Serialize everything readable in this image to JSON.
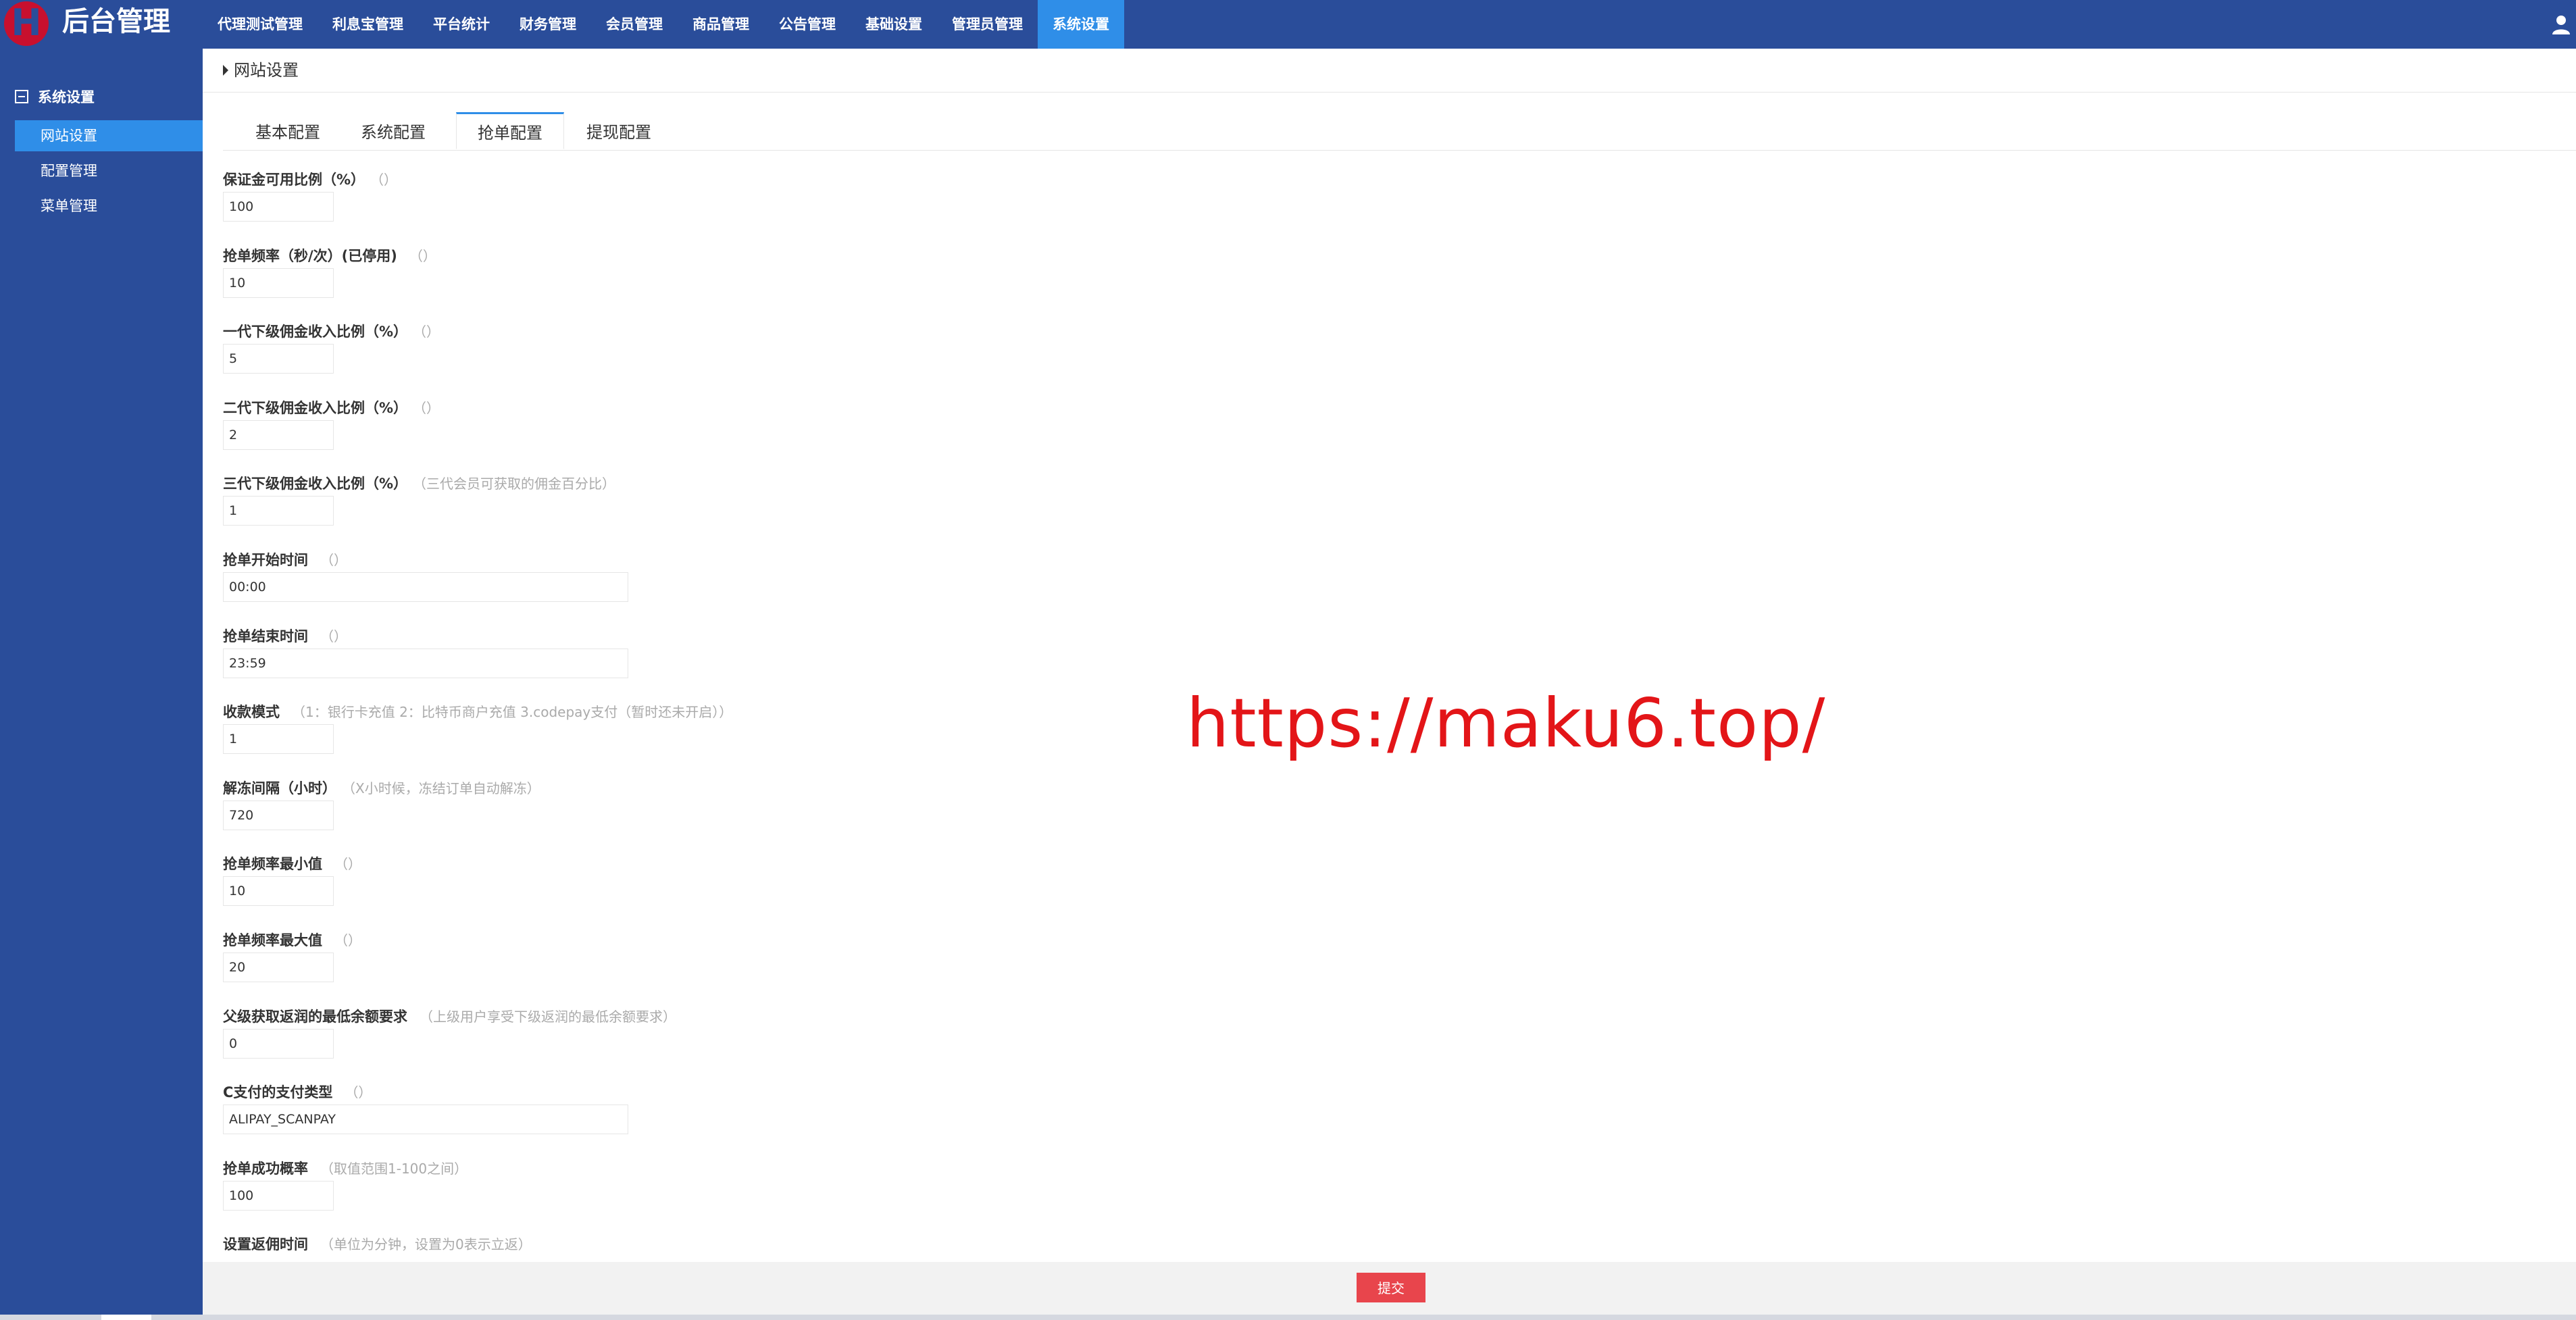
{
  "app": {
    "logo_letter": "H",
    "logo_text": "后台管理"
  },
  "topnav": [
    {
      "label": "代理测试管理",
      "active": false
    },
    {
      "label": "利息宝管理",
      "active": false
    },
    {
      "label": "平台统计",
      "active": false
    },
    {
      "label": "财务管理",
      "active": false
    },
    {
      "label": "会员管理",
      "active": false
    },
    {
      "label": "商品管理",
      "active": false
    },
    {
      "label": "公告管理",
      "active": false
    },
    {
      "label": "基础设置",
      "active": false
    },
    {
      "label": "管理员管理",
      "active": false
    },
    {
      "label": "系统设置",
      "active": true
    }
  ],
  "sidebar": {
    "title": "系统设置",
    "items": [
      {
        "label": "网站设置",
        "active": true
      },
      {
        "label": "配置管理",
        "active": false
      },
      {
        "label": "菜单管理",
        "active": false
      }
    ]
  },
  "page": {
    "title": "网站设置",
    "tabs": [
      {
        "label": "基本配置",
        "active": false
      },
      {
        "label": "系统配置",
        "active": false
      },
      {
        "label": "抢单配置",
        "active": true
      },
      {
        "label": "提现配置",
        "active": false
      }
    ]
  },
  "fields": [
    {
      "label": "保证金可用比例（%）",
      "hint": "（）",
      "value": "100"
    },
    {
      "label": "抢单频率（秒/次）(已停用)",
      "hint": "（）",
      "value": "10"
    },
    {
      "label": "一代下级佣金收入比例（%）",
      "hint": "（）",
      "value": "5"
    },
    {
      "label": "二代下级佣金收入比例（%）",
      "hint": "（）",
      "value": "2"
    },
    {
      "label": "三代下级佣金收入比例（%）",
      "hint": "（三代会员可获取的佣金百分比）",
      "value": "1"
    },
    {
      "label": "抢单开始时间",
      "hint": "（）",
      "value": "00:00"
    },
    {
      "label": "抢单结束时间",
      "hint": "（）",
      "value": "23:59"
    },
    {
      "label": "收款模式",
      "hint": "（1：银行卡充值 2：比特币商户充值 3.codepay支付（暂时还未开启））",
      "value": "1"
    },
    {
      "label": "解冻间隔（小时）",
      "hint": "（X小时候，冻结订单自动解冻）",
      "value": "720"
    },
    {
      "label": "抢单频率最小值",
      "hint": "（）",
      "value": "10"
    },
    {
      "label": "抢单频率最大值",
      "hint": "（）",
      "value": "20"
    },
    {
      "label": "父级获取返润的最低余额要求",
      "hint": "（上级用户享受下级返润的最低余额要求）",
      "value": "0"
    },
    {
      "label": "C支付的支付类型",
      "hint": "（）",
      "value": "ALIPAY_SCANPAY"
    },
    {
      "label": "抢单成功概率",
      "hint": "（取值范围1-100之间）",
      "value": "100"
    },
    {
      "label": "设置返佣时间",
      "hint": "（单位为分钟，设置为0表示立返）",
      "value": ""
    }
  ],
  "watermark": "https://maku6.top/",
  "submit_label": "提交",
  "icons": {
    "user": "user-icon",
    "sidebar_toggle": "minus-square-icon",
    "page_caret": "caret-right-icon"
  },
  "colors": {
    "nav_bg": "#2a4d9a",
    "active": "#2f8ee8",
    "submit": "#e8454c",
    "watermark": "#e31518"
  }
}
